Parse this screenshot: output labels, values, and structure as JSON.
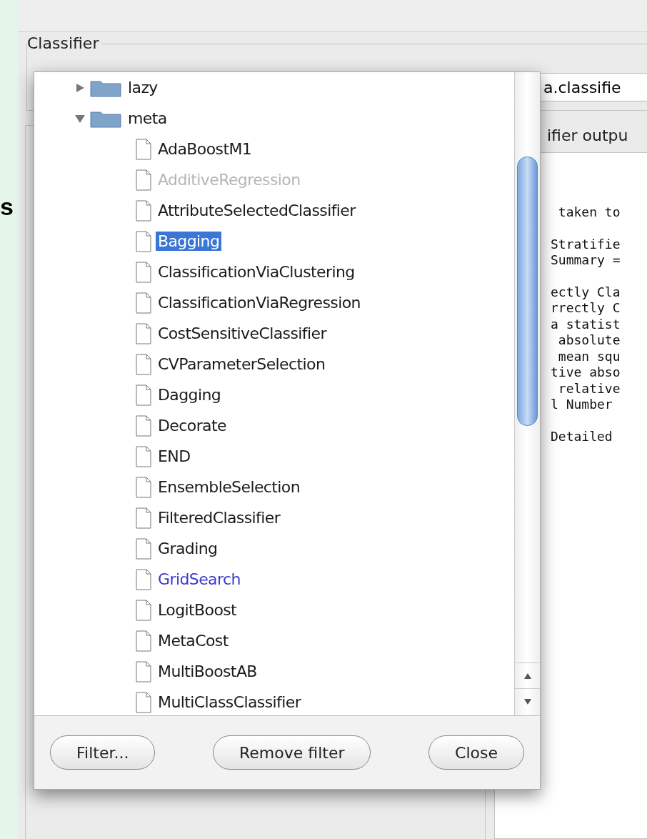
{
  "side_letter": "s",
  "classifier_group": {
    "title": "Classifier",
    "field_value": "a.classifie"
  },
  "output_panel": {
    "title": "ifier outpu",
    "blocks": [
      [
        " taken to"
      ],
      [
        "Stratifie",
        "Summary ="
      ],
      [
        "ectly Cla",
        "rrectly C",
        "a statist",
        " absolute",
        " mean squ",
        "tive abso",
        " relative",
        "l Number"
      ],
      [
        "Detailed"
      ]
    ]
  },
  "chooser": {
    "tree": [
      {
        "label": "lazy",
        "expanded": false
      },
      {
        "label": "meta",
        "expanded": true,
        "children": [
          {
            "label": "AdaBoostM1",
            "selected": false,
            "disabled": false,
            "highlighted": false
          },
          {
            "label": "AdditiveRegression",
            "selected": false,
            "disabled": true,
            "highlighted": false
          },
          {
            "label": "AttributeSelectedClassifier",
            "selected": false,
            "disabled": false,
            "highlighted": false
          },
          {
            "label": "Bagging",
            "selected": true,
            "disabled": false,
            "highlighted": false
          },
          {
            "label": "ClassificationViaClustering",
            "selected": false,
            "disabled": false,
            "highlighted": false
          },
          {
            "label": "ClassificationViaRegression",
            "selected": false,
            "disabled": false,
            "highlighted": false
          },
          {
            "label": "CostSensitiveClassifier",
            "selected": false,
            "disabled": false,
            "highlighted": false
          },
          {
            "label": "CVParameterSelection",
            "selected": false,
            "disabled": false,
            "highlighted": false
          },
          {
            "label": "Dagging",
            "selected": false,
            "disabled": false,
            "highlighted": false
          },
          {
            "label": "Decorate",
            "selected": false,
            "disabled": false,
            "highlighted": false
          },
          {
            "label": "END",
            "selected": false,
            "disabled": false,
            "highlighted": false
          },
          {
            "label": "EnsembleSelection",
            "selected": false,
            "disabled": false,
            "highlighted": false
          },
          {
            "label": "FilteredClassifier",
            "selected": false,
            "disabled": false,
            "highlighted": false
          },
          {
            "label": "Grading",
            "selected": false,
            "disabled": false,
            "highlighted": false
          },
          {
            "label": "GridSearch",
            "selected": false,
            "disabled": false,
            "highlighted": true
          },
          {
            "label": "LogitBoost",
            "selected": false,
            "disabled": false,
            "highlighted": false
          },
          {
            "label": "MetaCost",
            "selected": false,
            "disabled": false,
            "highlighted": false
          },
          {
            "label": "MultiBoostAB",
            "selected": false,
            "disabled": false,
            "highlighted": false
          },
          {
            "label": "MultiClassClassifier",
            "selected": false,
            "disabled": false,
            "highlighted": false
          }
        ]
      }
    ],
    "buttons": [
      "Filter...",
      "Remove filter",
      "Close"
    ]
  }
}
